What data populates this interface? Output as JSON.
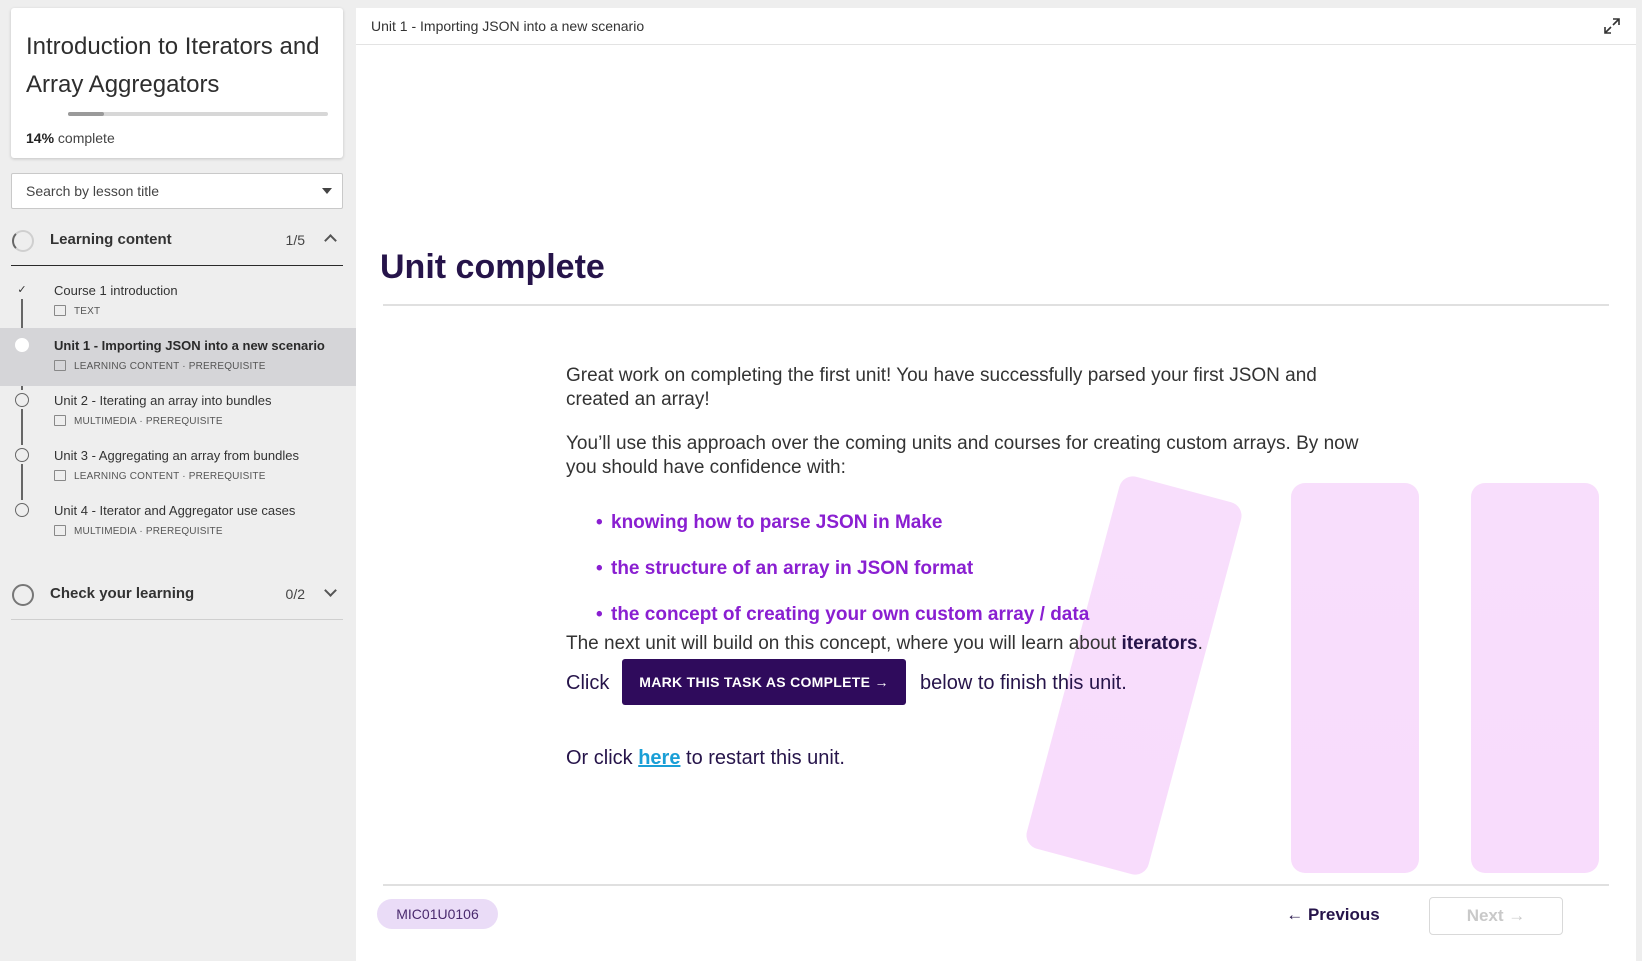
{
  "course": {
    "title": "Introduction to Iterators and Array Aggregators",
    "progress_percent": 14,
    "progress_value": "14%",
    "progress_suffix": "complete"
  },
  "search": {
    "placeholder": "Search by lesson title"
  },
  "sections": [
    {
      "title": "Learning content",
      "count": "1/5",
      "expanded": true,
      "lessons": [
        {
          "title": "Course 1 introduction",
          "meta": "TEXT",
          "status": "done"
        },
        {
          "title": "Unit 1 - Importing JSON into a new scenario",
          "meta": "LEARNING CONTENT · PREREQUISITE",
          "status": "current"
        },
        {
          "title": "Unit 2 - Iterating an array into bundles",
          "meta": "MULTIMEDIA · PREREQUISITE",
          "status": "todo"
        },
        {
          "title": "Unit 3 - Aggregating an array from bundles",
          "meta": "LEARNING CONTENT · PREREQUISITE",
          "status": "todo"
        },
        {
          "title": "Unit 4 - Iterator and Aggregator use cases",
          "meta": "MULTIMEDIA · PREREQUISITE",
          "status": "todo"
        }
      ]
    },
    {
      "title": "Check your learning",
      "count": "0/2",
      "expanded": false
    }
  ],
  "topbar": {
    "title": "Unit 1 - Importing JSON into a new scenario"
  },
  "main": {
    "heading": "Unit complete",
    "para1": "Great work on completing the first unit! You have successfully parsed your first JSON and created an array!",
    "para2": "You’ll use this approach over the coming units and courses for creating custom arrays. By now you should have confidence with:",
    "bullets": [
      "knowing how to parse JSON in Make",
      "the structure of an array in JSON format",
      "the concept of creating your own custom array / data"
    ],
    "para3_prefix": "The next unit will build on this concept, where you will learn about ",
    "para3_bold": "iterators",
    "para3_suffix": ".",
    "click_prefix": "Click",
    "mark_button": "MARK THIS TASK AS COMPLETE →",
    "click_suffix": "below to finish this unit.",
    "restart_prefix": "Or click ",
    "restart_link": "here",
    "restart_suffix": " to restart this unit."
  },
  "footer": {
    "lesson_code": "MIC01U0106",
    "previous_label": "← Previous",
    "next_label": "Next →"
  },
  "colors": {
    "accent_purple": "#8a1fd1",
    "button_dark": "#2f0b5c",
    "link_blue": "#1a9fd6",
    "deco_pink": "#f5d0fa"
  }
}
